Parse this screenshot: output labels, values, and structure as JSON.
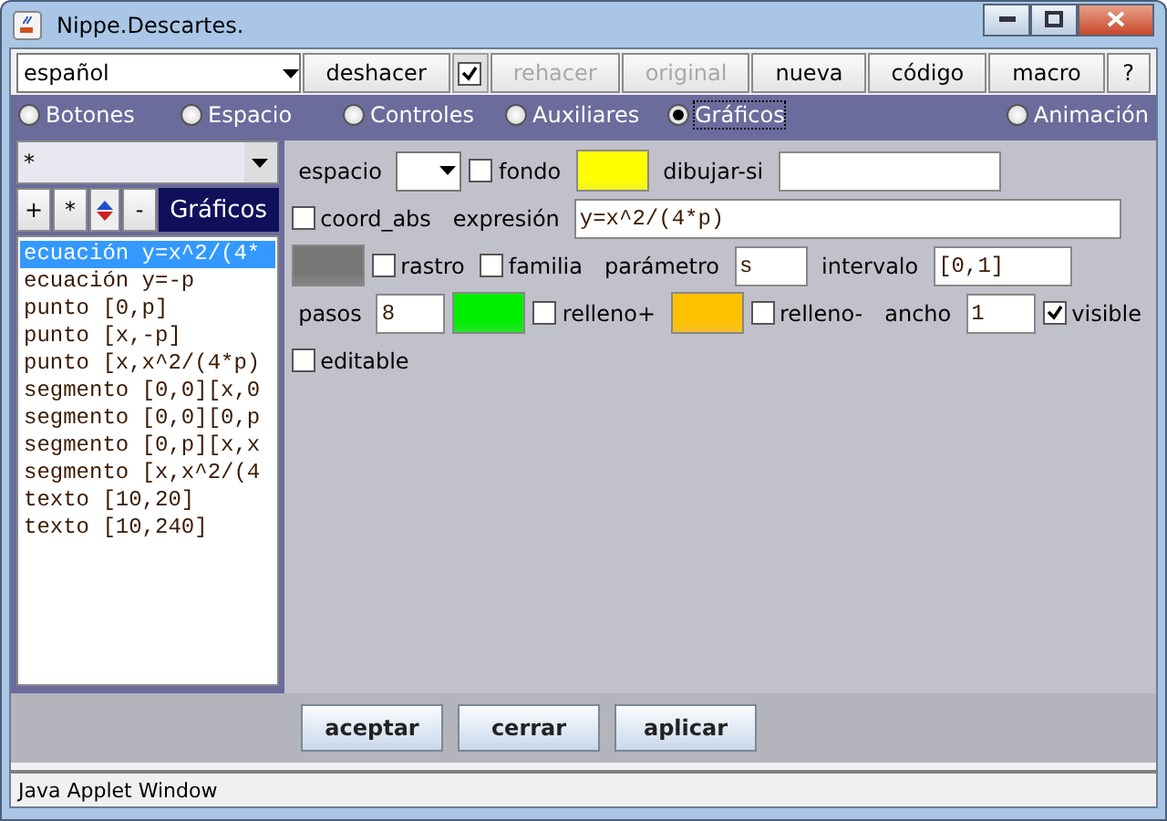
{
  "window": {
    "title": "Nippe.Descartes."
  },
  "toolbar": {
    "language": "español",
    "items": [
      {
        "kind": "button",
        "label": "deshacer",
        "disabled": false
      },
      {
        "kind": "checkbox",
        "checked": true
      },
      {
        "kind": "button",
        "label": "rehacer",
        "disabled": true
      },
      {
        "kind": "button",
        "label": "original",
        "disabled": true
      },
      {
        "kind": "button",
        "label": "nueva",
        "disabled": false
      },
      {
        "kind": "button",
        "label": "código",
        "disabled": false
      },
      {
        "kind": "button",
        "label": "macro",
        "disabled": false
      },
      {
        "kind": "button",
        "label": "?",
        "disabled": false
      }
    ]
  },
  "sections": [
    {
      "label": "Botones",
      "selected": false
    },
    {
      "label": "Espacio",
      "selected": false
    },
    {
      "label": "Controles",
      "selected": false
    },
    {
      "label": "Auxiliares",
      "selected": false
    },
    {
      "label": "Gráficos",
      "selected": true
    },
    {
      "label": "Animación",
      "selected": false
    }
  ],
  "left_panel": {
    "filter": "*",
    "buttons": [
      "+",
      "*",
      "-"
    ],
    "title": "Gráficos",
    "items": [
      {
        "label": "ecuación y=x^2/(4*",
        "selected": true
      },
      {
        "label": "ecuación y=-p",
        "selected": false
      },
      {
        "label": "punto [0,p]",
        "selected": false
      },
      {
        "label": "punto [x,-p]",
        "selected": false
      },
      {
        "label": "punto [x,x^2/(4*p)",
        "selected": false
      },
      {
        "label": "segmento [0,0][x,0",
        "selected": false
      },
      {
        "label": "segmento [0,0][0,p",
        "selected": false
      },
      {
        "label": "segmento [0,p][x,x",
        "selected": false
      },
      {
        "label": "segmento [x,x^2/(4",
        "selected": false
      },
      {
        "label": "texto [10,20]",
        "selected": false
      },
      {
        "label": "texto [10,240]",
        "selected": false
      }
    ]
  },
  "form": [
    [
      {
        "kind": "label",
        "text": "espacio"
      },
      {
        "kind": "select"
      },
      {
        "kind": "checkbox",
        "label": "fondo",
        "checked": false
      },
      {
        "kind": "color",
        "color": "#ffff00"
      },
      {
        "kind": "label",
        "text": "dibujar-si"
      },
      {
        "kind": "input"
      }
    ],
    [
      {
        "kind": "checkbox",
        "label": "coord_abs",
        "checked": false
      },
      {
        "kind": "label",
        "text": "expresión"
      },
      {
        "kind": "input",
        "value": "y=x^2/(4*p)"
      }
    ],
    [
      {
        "kind": "color",
        "color": "#777777"
      },
      {
        "kind": "checkbox",
        "label": "rastro",
        "checked": false
      },
      {
        "kind": "checkbox",
        "label": "familia",
        "checked": false
      },
      {
        "kind": "label",
        "text": "parámetro"
      },
      {
        "kind": "input",
        "value": "s"
      },
      {
        "kind": "label",
        "text": "intervalo"
      },
      {
        "kind": "input",
        "value": "[0,1]"
      }
    ],
    [
      {
        "kind": "label",
        "text": "pasos"
      },
      {
        "kind": "input",
        "value": "8"
      },
      {
        "kind": "color",
        "color": "#00ee00"
      },
      {
        "kind": "checkbox",
        "label": "relleno+",
        "checked": false
      },
      {
        "kind": "color",
        "color": "#ffc000"
      },
      {
        "kind": "checkbox",
        "label": "relleno-",
        "checked": false
      },
      {
        "kind": "label",
        "text": "ancho"
      },
      {
        "kind": "input",
        "value": "1"
      },
      {
        "kind": "checkbox",
        "label": "visible",
        "checked": true
      }
    ],
    [
      {
        "kind": "checkbox",
        "label": "editable",
        "checked": false
      }
    ]
  ],
  "actions": [
    "aceptar",
    "cerrar",
    "aplicar"
  ],
  "status": "Java Applet Window"
}
